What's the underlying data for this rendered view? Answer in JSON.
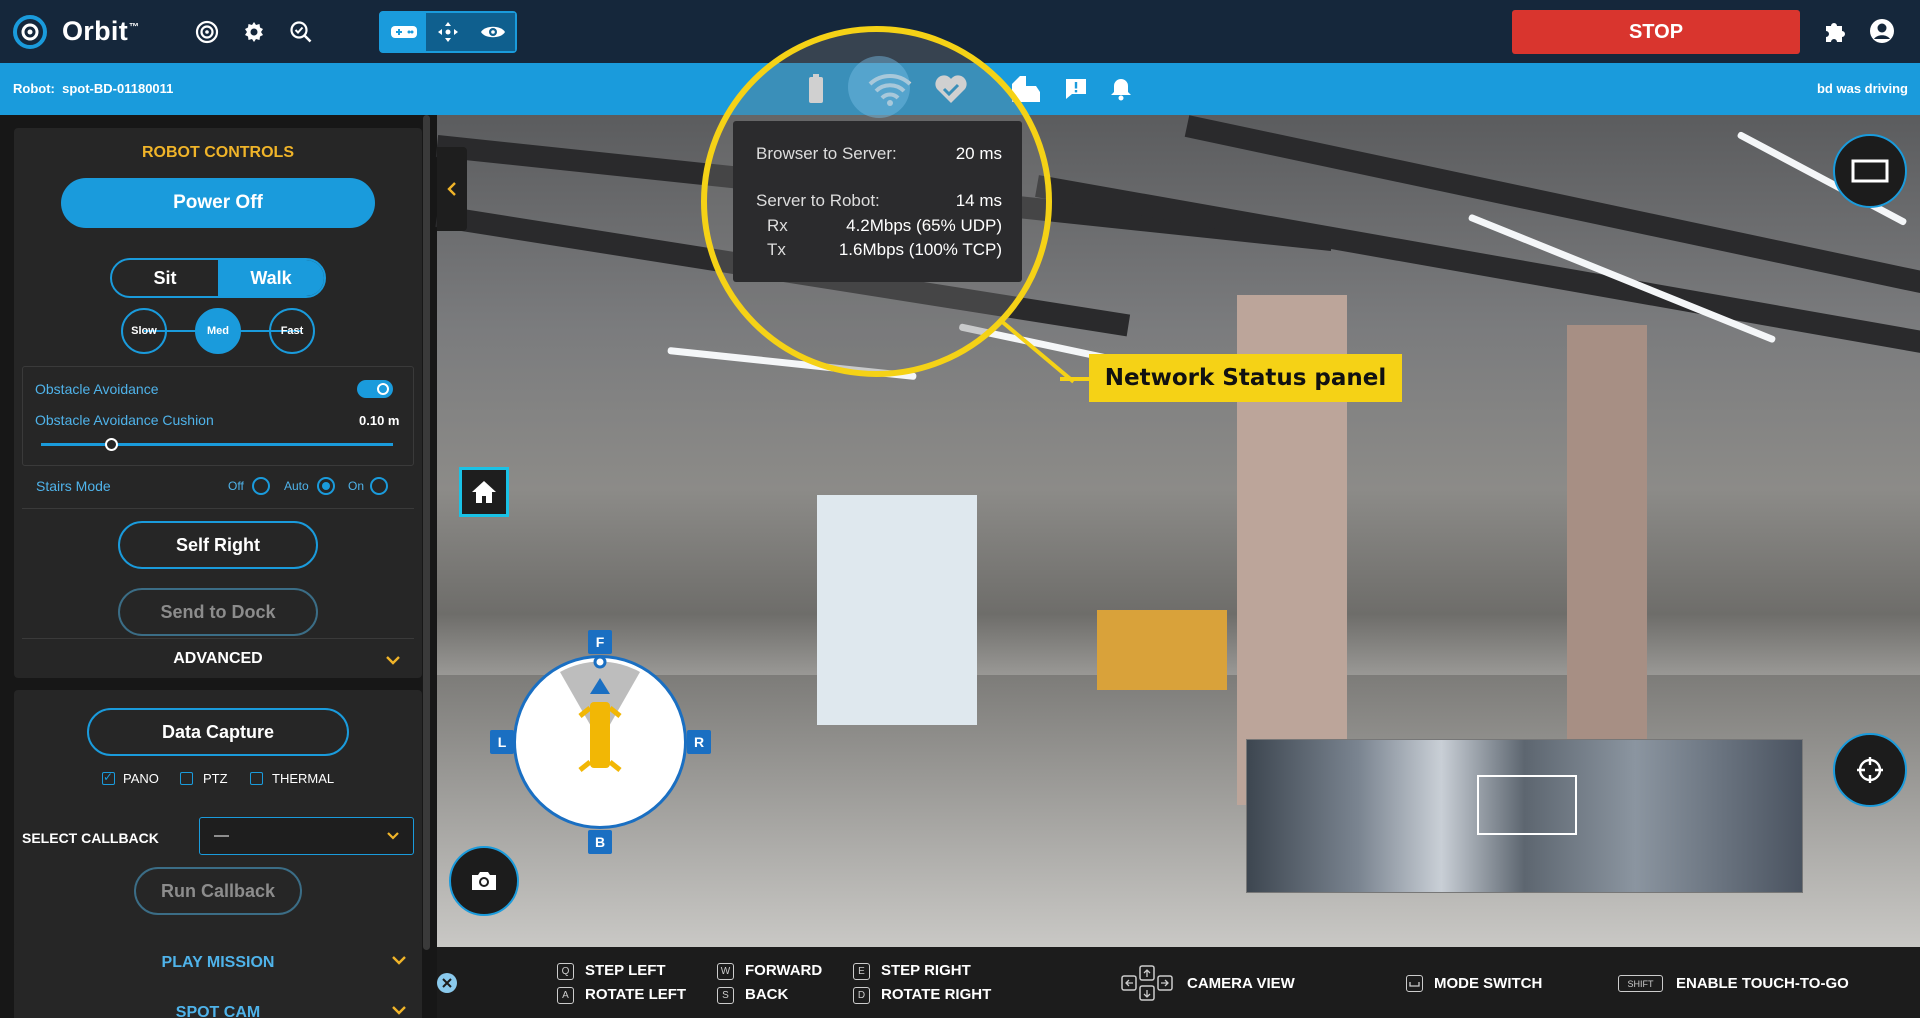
{
  "app": {
    "name": "Orbit",
    "trademark": "™"
  },
  "top": {
    "stop_label": "STOP",
    "icons": [
      "target-icon",
      "gear-icon",
      "check-magnifier-icon"
    ],
    "mode_icons": [
      "gamepad-icon",
      "move-arrows-icon",
      "eye-icon"
    ],
    "right_icons": [
      "puzzle-icon",
      "user-icon"
    ]
  },
  "subbar": {
    "robot_label": "Robot:",
    "robot_id": "spot-BD-01180011",
    "driver_status": "bd was driving"
  },
  "controls": {
    "title": "ROBOT CONTROLS",
    "power_label": "Power Off",
    "sit_label": "Sit",
    "walk_label": "Walk",
    "speeds": [
      "Slow",
      "Med",
      "Fast"
    ],
    "obstacle_avoidance_label": "Obstacle Avoidance",
    "cushion_label": "Obstacle Avoidance Cushion",
    "cushion_value": "0.10 m",
    "cushion_fraction": 0.2,
    "stairs_label": "Stairs Mode",
    "stairs_off": "Off",
    "stairs_auto": "Auto",
    "stairs_on": "On",
    "self_right_label": "Self Right",
    "send_dock_label": "Send to Dock",
    "advanced_label": "ADVANCED"
  },
  "capture": {
    "data_capture_label": "Data Capture",
    "pano": "PANO",
    "ptz": "PTZ",
    "thermal": "THERMAL",
    "callback_label": "SELECT CALLBACK",
    "callback_value": "—",
    "run_callback_label": "Run Callback"
  },
  "sections": {
    "play_mission": "PLAY MISSION",
    "spot_cam": "SPOT CAM"
  },
  "compass": {
    "front": "F",
    "back": "B",
    "left": "L",
    "right": "R"
  },
  "network": {
    "browser_label": "Browser to Server:",
    "browser_value": "20 ms",
    "robot_label": "Server to Robot:",
    "robot_value": "14 ms",
    "rx_label": "Rx",
    "rx_value": "4.2Mbps (65% UDP)",
    "tx_label": "Tx",
    "tx_value": "1.6Mbps (100% TCP)",
    "callout": "Network Status panel"
  },
  "shortcuts": {
    "step_left": "STEP LEFT",
    "key_q": "Q",
    "rotate_left": "ROTATE LEFT",
    "key_a": "A",
    "forward": "FORWARD",
    "key_w": "W",
    "back": "BACK",
    "key_s": "S",
    "step_right": "STEP RIGHT",
    "key_e": "E",
    "rotate_right": "ROTATE RIGHT",
    "key_d": "D",
    "camera_view": "CAMERA VIEW",
    "mode_switch": "MODE SWITCH",
    "shift_key": "SHIFT",
    "touch_to_go": "ENABLE TOUCH-TO-GO"
  },
  "colors": {
    "accent": "#1a9bdc",
    "stop": "#d9352e",
    "highlight": "#f5d216",
    "title": "#f0b429"
  }
}
